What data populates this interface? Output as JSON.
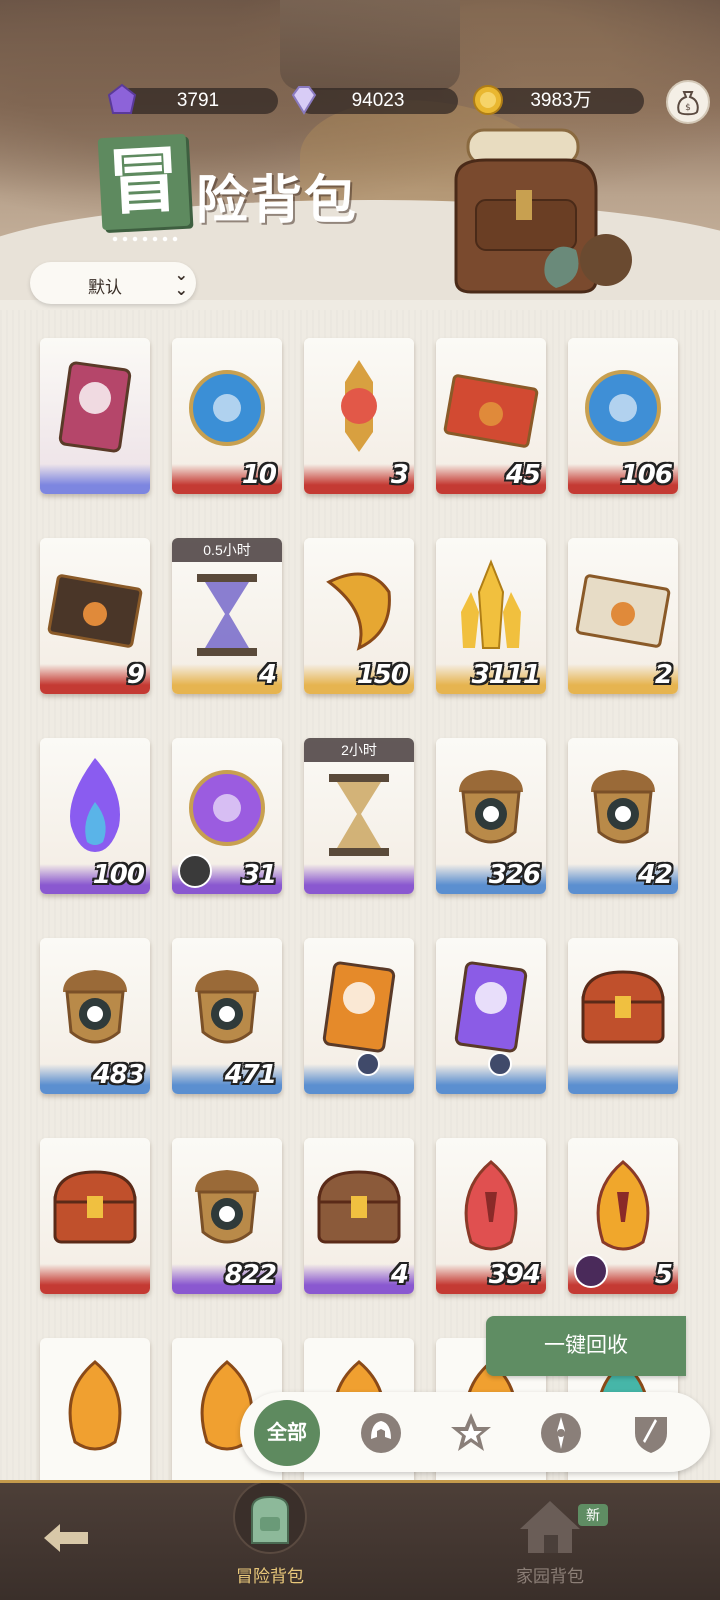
{
  "resources": [
    {
      "icon": "purple-crystal-icon",
      "value": "3791",
      "color": "#8d63d9"
    },
    {
      "icon": "diamond-icon",
      "value": "94023",
      "color": "#c7b8f0"
    },
    {
      "icon": "gold-coin-icon",
      "value": "3983万",
      "color": "#e9b730"
    }
  ],
  "money_bag_icon": "money-bag-icon",
  "title": {
    "first_char": "冒",
    "rest": "险背包"
  },
  "sort": {
    "label": "默认",
    "icon": "double-chevron-down-icon"
  },
  "items": [
    {
      "name": "ticket",
      "count": "",
      "bg": "#ece0e6",
      "wave": "#7d86e0",
      "icon_color": "#b5466a"
    },
    {
      "name": "blue-orb",
      "count": "10",
      "bg": "#f3ece3",
      "wave": "#c43a33",
      "icon_color": "#3b8fd6"
    },
    {
      "name": "red-gem-medallion",
      "count": "3",
      "bg": "#f3ece3",
      "wave": "#c43a33",
      "icon_color": "#e25848"
    },
    {
      "name": "red-envelope",
      "count": "45",
      "bg": "#f3ece3",
      "wave": "#c43a33",
      "icon_color": "#d24a32"
    },
    {
      "name": "blue-star-orb",
      "count": "106",
      "bg": "#f3ece3",
      "wave": "#c43a33",
      "icon_color": "#3f8fd6"
    },
    {
      "name": "dark-envelope",
      "count": "9",
      "bg": "#f3ece3",
      "wave": "#c43a33",
      "icon_color": "#4a3628"
    },
    {
      "name": "hourglass-purple",
      "count": "4",
      "bg": "#f3ece3",
      "wave": "#e6b450",
      "icon_color": "#6e60c8",
      "timer": "0.5小时"
    },
    {
      "name": "golden-croissant",
      "count": "150",
      "bg": "#f3ece3",
      "wave": "#e6b450",
      "icon_color": "#e6a732"
    },
    {
      "name": "gold-crystal",
      "count": "3111",
      "bg": "#f3ece3",
      "wave": "#e6b450",
      "icon_color": "#f1c03e"
    },
    {
      "name": "white-envelope",
      "count": "2",
      "bg": "#f3ece3",
      "wave": "#e6b450",
      "icon_color": "#e7dcc6"
    },
    {
      "name": "purple-flame",
      "count": "100",
      "bg": "#f3ece3",
      "wave": "#8a58d0",
      "icon_color": "#8a5cf0"
    },
    {
      "name": "purple-trident-orb",
      "count": "31",
      "bg": "#f3ece3",
      "wave": "#8a58d0",
      "icon_color": "#9b5ce0",
      "corner": "puzzle-icon"
    },
    {
      "name": "hourglass-gold",
      "count": "",
      "bg": "#f3ece3",
      "wave": "#8a58d0",
      "icon_color": "#c9a25a",
      "timer": "2小时"
    },
    {
      "name": "acorn-eye",
      "count": "326",
      "bg": "#f3ece3",
      "wave": "#5b8fd0",
      "icon_color": "#b98a49"
    },
    {
      "name": "acorn-target",
      "count": "42",
      "bg": "#f3ece3",
      "wave": "#5b8fd0",
      "icon_color": "#b98a49"
    },
    {
      "name": "acorn-leaf",
      "count": "483",
      "bg": "#f3ece3",
      "wave": "#5b8fd0",
      "icon_color": "#b98a49"
    },
    {
      "name": "acorn-star",
      "count": "471",
      "bg": "#f3ece3",
      "wave": "#5b8fd0",
      "icon_color": "#b98a49"
    },
    {
      "name": "orange-helmet-ticket",
      "count": "",
      "bg": "#f3ece3",
      "wave": "#5b8fd0",
      "icon_color": "#e58a2a",
      "mini": "compass-icon"
    },
    {
      "name": "purple-helmet-ticket",
      "count": "",
      "bg": "#f3ece3",
      "wave": "#5b8fd0",
      "icon_color": "#8b5ce6",
      "mini": "compass-icon"
    },
    {
      "name": "red-treasure-chest",
      "count": "",
      "bg": "#f3ece3",
      "wave": "#5b8fd0",
      "icon_color": "#c0502c"
    },
    {
      "name": "red-treasure-chest-2",
      "count": "",
      "bg": "#f3ece3",
      "wave": "#c43a33",
      "icon_color": "#c0502c"
    },
    {
      "name": "acorn-diamond",
      "count": "822",
      "bg": "#f3ece3",
      "wave": "#8a58d0",
      "icon_color": "#b98a49"
    },
    {
      "name": "wooden-chest",
      "count": "4",
      "bg": "#f3ece3",
      "wave": "#8a58d0",
      "icon_color": "#8b5a3a"
    },
    {
      "name": "red-rune-gem",
      "count": "394",
      "bg": "#f3ece3",
      "wave": "#c43a33",
      "icon_color": "#e05050"
    },
    {
      "name": "gold-rune-gem",
      "count": "5",
      "bg": "#f3ece3",
      "wave": "#c43a33",
      "icon_color": "#f0a72c",
      "avatar": "avatar"
    }
  ],
  "partial_items": [
    {
      "name": "orange-rune-1",
      "color": "#f0a030"
    },
    {
      "name": "orange-rune-2",
      "color": "#f0a030"
    },
    {
      "name": "orange-rune-3",
      "color": "#f0a030"
    },
    {
      "name": "orange-rune-4",
      "color": "#f0a030"
    },
    {
      "name": "teal-rune-5",
      "color": "#46b6a8"
    }
  ],
  "recycle_label": "一键回收",
  "filters": {
    "all_label": "全部",
    "icons": [
      "helmet-filter-icon",
      "star-badge-filter-icon",
      "compass-filter-icon",
      "sword-shield-filter-icon"
    ]
  },
  "nav": {
    "back_icon": "back-arrow-icon",
    "adventure_label": "冒险背包",
    "home_label": "家园背包",
    "new_badge": "新"
  }
}
